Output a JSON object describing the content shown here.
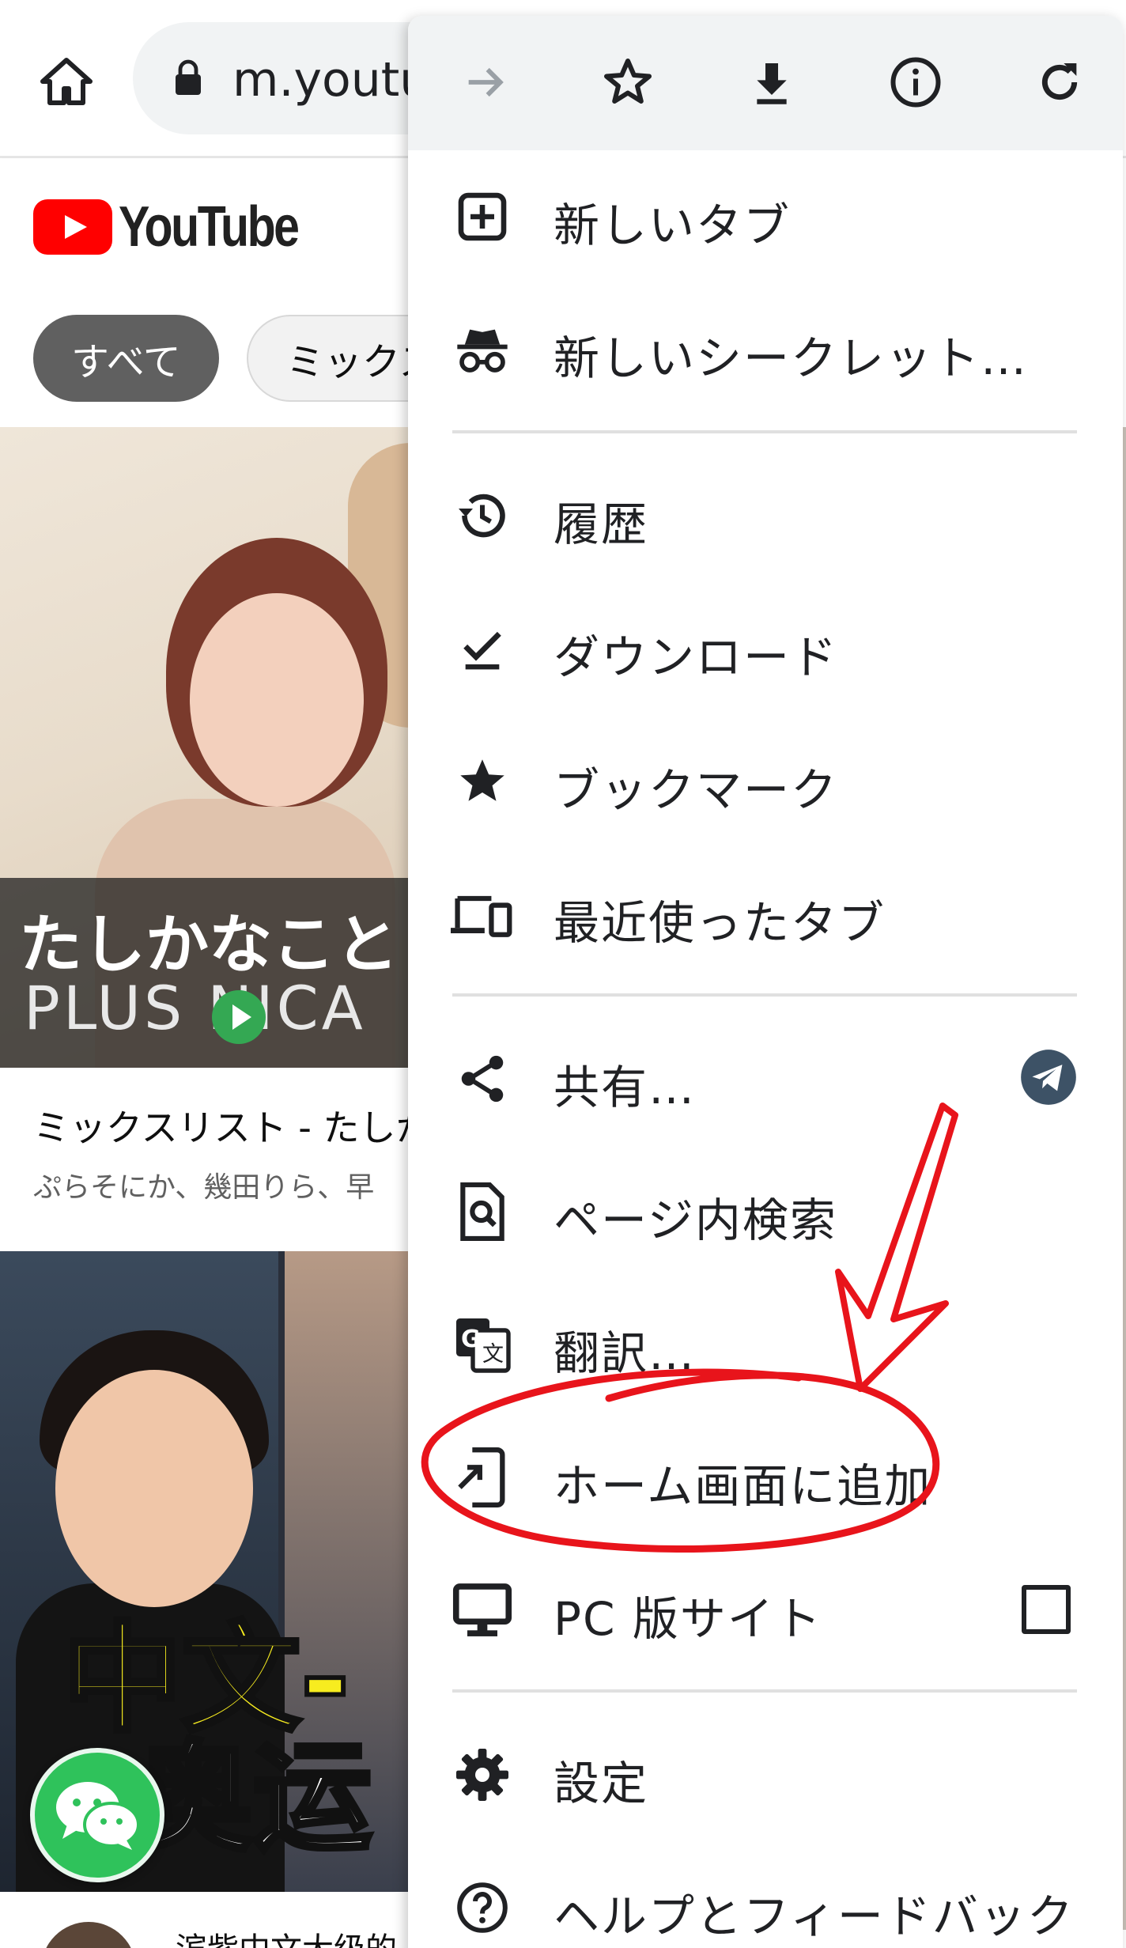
{
  "browser": {
    "url": "m.youtu",
    "home_icon": "home-icon",
    "lock_icon": "lock-icon"
  },
  "youtube": {
    "logo_text": "YouTube",
    "chips": [
      "すべて",
      "ミックス"
    ],
    "videos": [
      {
        "thumbnail_caption": "たしかなこと",
        "thumbnail_brand": "PLUS NICA",
        "title": "ミックスリスト - たしか",
        "meta": "ぷらそにか、幾田りら、早"
      },
      {
        "thumbnail_text_yellow": "中文-",
        "thumbnail_text_white": "奥运",
        "title": "滨紫中文大级的"
      }
    ]
  },
  "menu": {
    "top_icons": [
      "forward-icon",
      "bookmark-star-icon",
      "download-icon",
      "info-icon",
      "reload-icon"
    ],
    "items": [
      {
        "label": "新しいタブ",
        "icon": "new-tab-icon"
      },
      {
        "label": "新しいシークレット…",
        "icon": "incognito-icon"
      },
      {
        "label": "履歴",
        "icon": "history-icon"
      },
      {
        "label": "ダウンロード",
        "icon": "downloads-icon"
      },
      {
        "label": "ブックマーク",
        "icon": "bookmarks-icon"
      },
      {
        "label": "最近使ったタブ",
        "icon": "recent-tabs-icon"
      },
      {
        "label": "共有…",
        "icon": "share-icon",
        "trailing": "telegram-icon"
      },
      {
        "label": "ページ内検索",
        "icon": "find-in-page-icon"
      },
      {
        "label": "翻訳…",
        "icon": "translate-icon"
      },
      {
        "label": "ホーム画面に追加",
        "icon": "add-to-home-icon",
        "highlighted": true
      },
      {
        "label": "PC 版サイト",
        "icon": "desktop-icon",
        "checked": false
      },
      {
        "label": "設定",
        "icon": "settings-icon"
      },
      {
        "label": "ヘルプとフィードバック",
        "icon": "help-icon"
      }
    ]
  },
  "annotation": {
    "color": "#e8141b",
    "shapes": [
      "arrow",
      "ellipse"
    ]
  }
}
